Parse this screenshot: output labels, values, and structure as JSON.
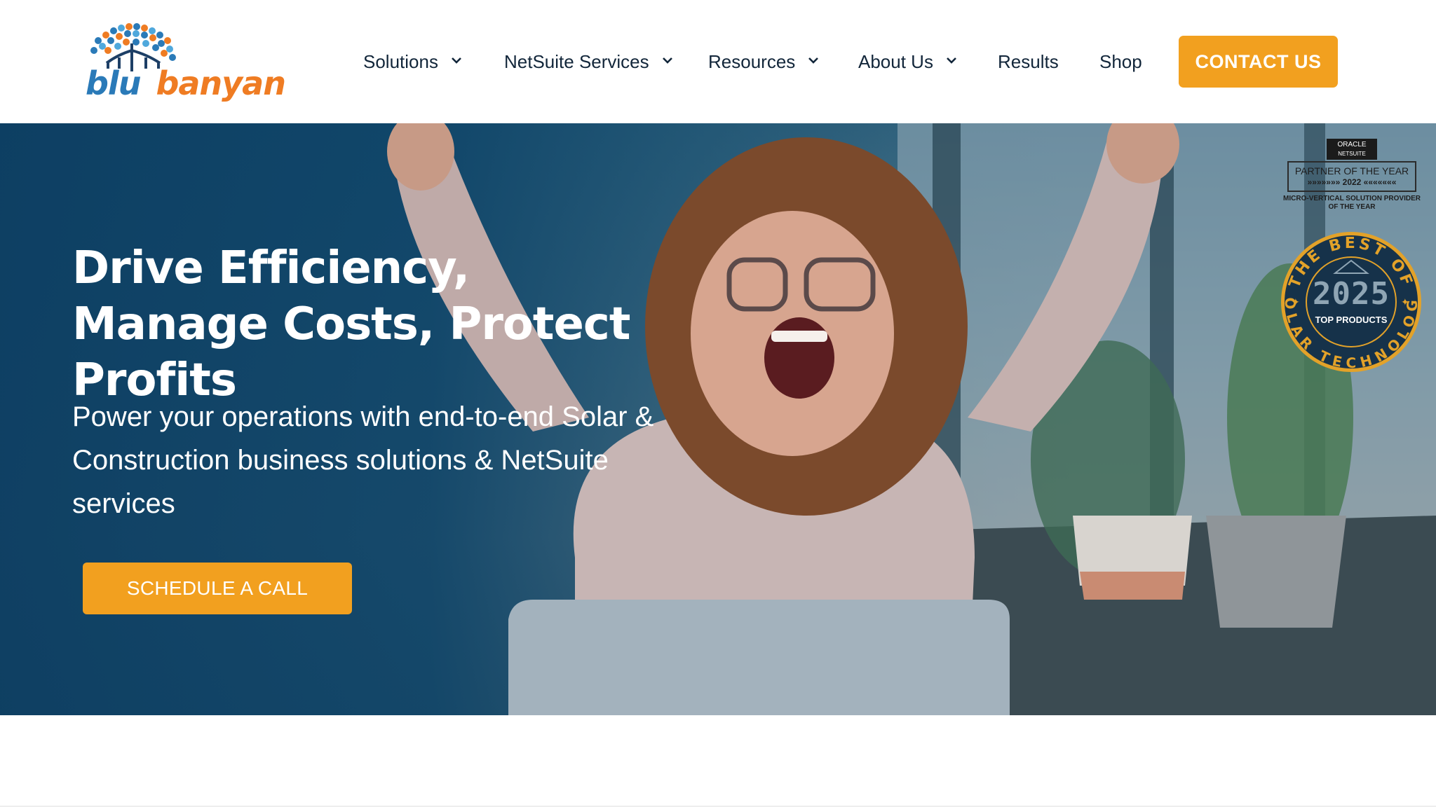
{
  "brand": {
    "logo_text_part1": "blu",
    "logo_text_part2": "banyan",
    "color_blue": "#2a7ab8",
    "color_orange": "#ef7c23"
  },
  "nav": {
    "items": [
      {
        "label": "Solutions",
        "dropdown": true
      },
      {
        "label": "NetSuite Services",
        "dropdown": true
      },
      {
        "label": "Resources",
        "dropdown": true
      },
      {
        "label": "About Us",
        "dropdown": true
      },
      {
        "label": "Results",
        "dropdown": false
      },
      {
        "label": "Shop",
        "dropdown": false
      }
    ],
    "chevron_icon": "chevron-down-icon",
    "contact_label": "CONTACT US"
  },
  "hero": {
    "title": "Drive Efficiency, Manage Costs, Protect Profits",
    "subtitle": "Power your operations with end-to-end Solar & Construction business solutions & NetSuite services",
    "cta_label": "SCHEDULE A CALL"
  },
  "badges": {
    "partner": {
      "oracle": "ORACLE",
      "netsuite": "NETSUITE",
      "line1": "PARTNER OF THE YEAR",
      "line2": "»»»»»»» 2022 «««««««",
      "caption": "MICRO-VERTICAL SOLUTION PROVIDER OF THE YEAR"
    },
    "best_of": {
      "ring_top": "THE BEST OF",
      "ring_bottom": "SOLAR TECHNOLOGY",
      "year": "2025",
      "label": "TOP PRODUCTS"
    }
  },
  "colors": {
    "accent": "#f2a01f",
    "nav_text": "#12263a",
    "hero_overlay": "#0c3e62"
  }
}
